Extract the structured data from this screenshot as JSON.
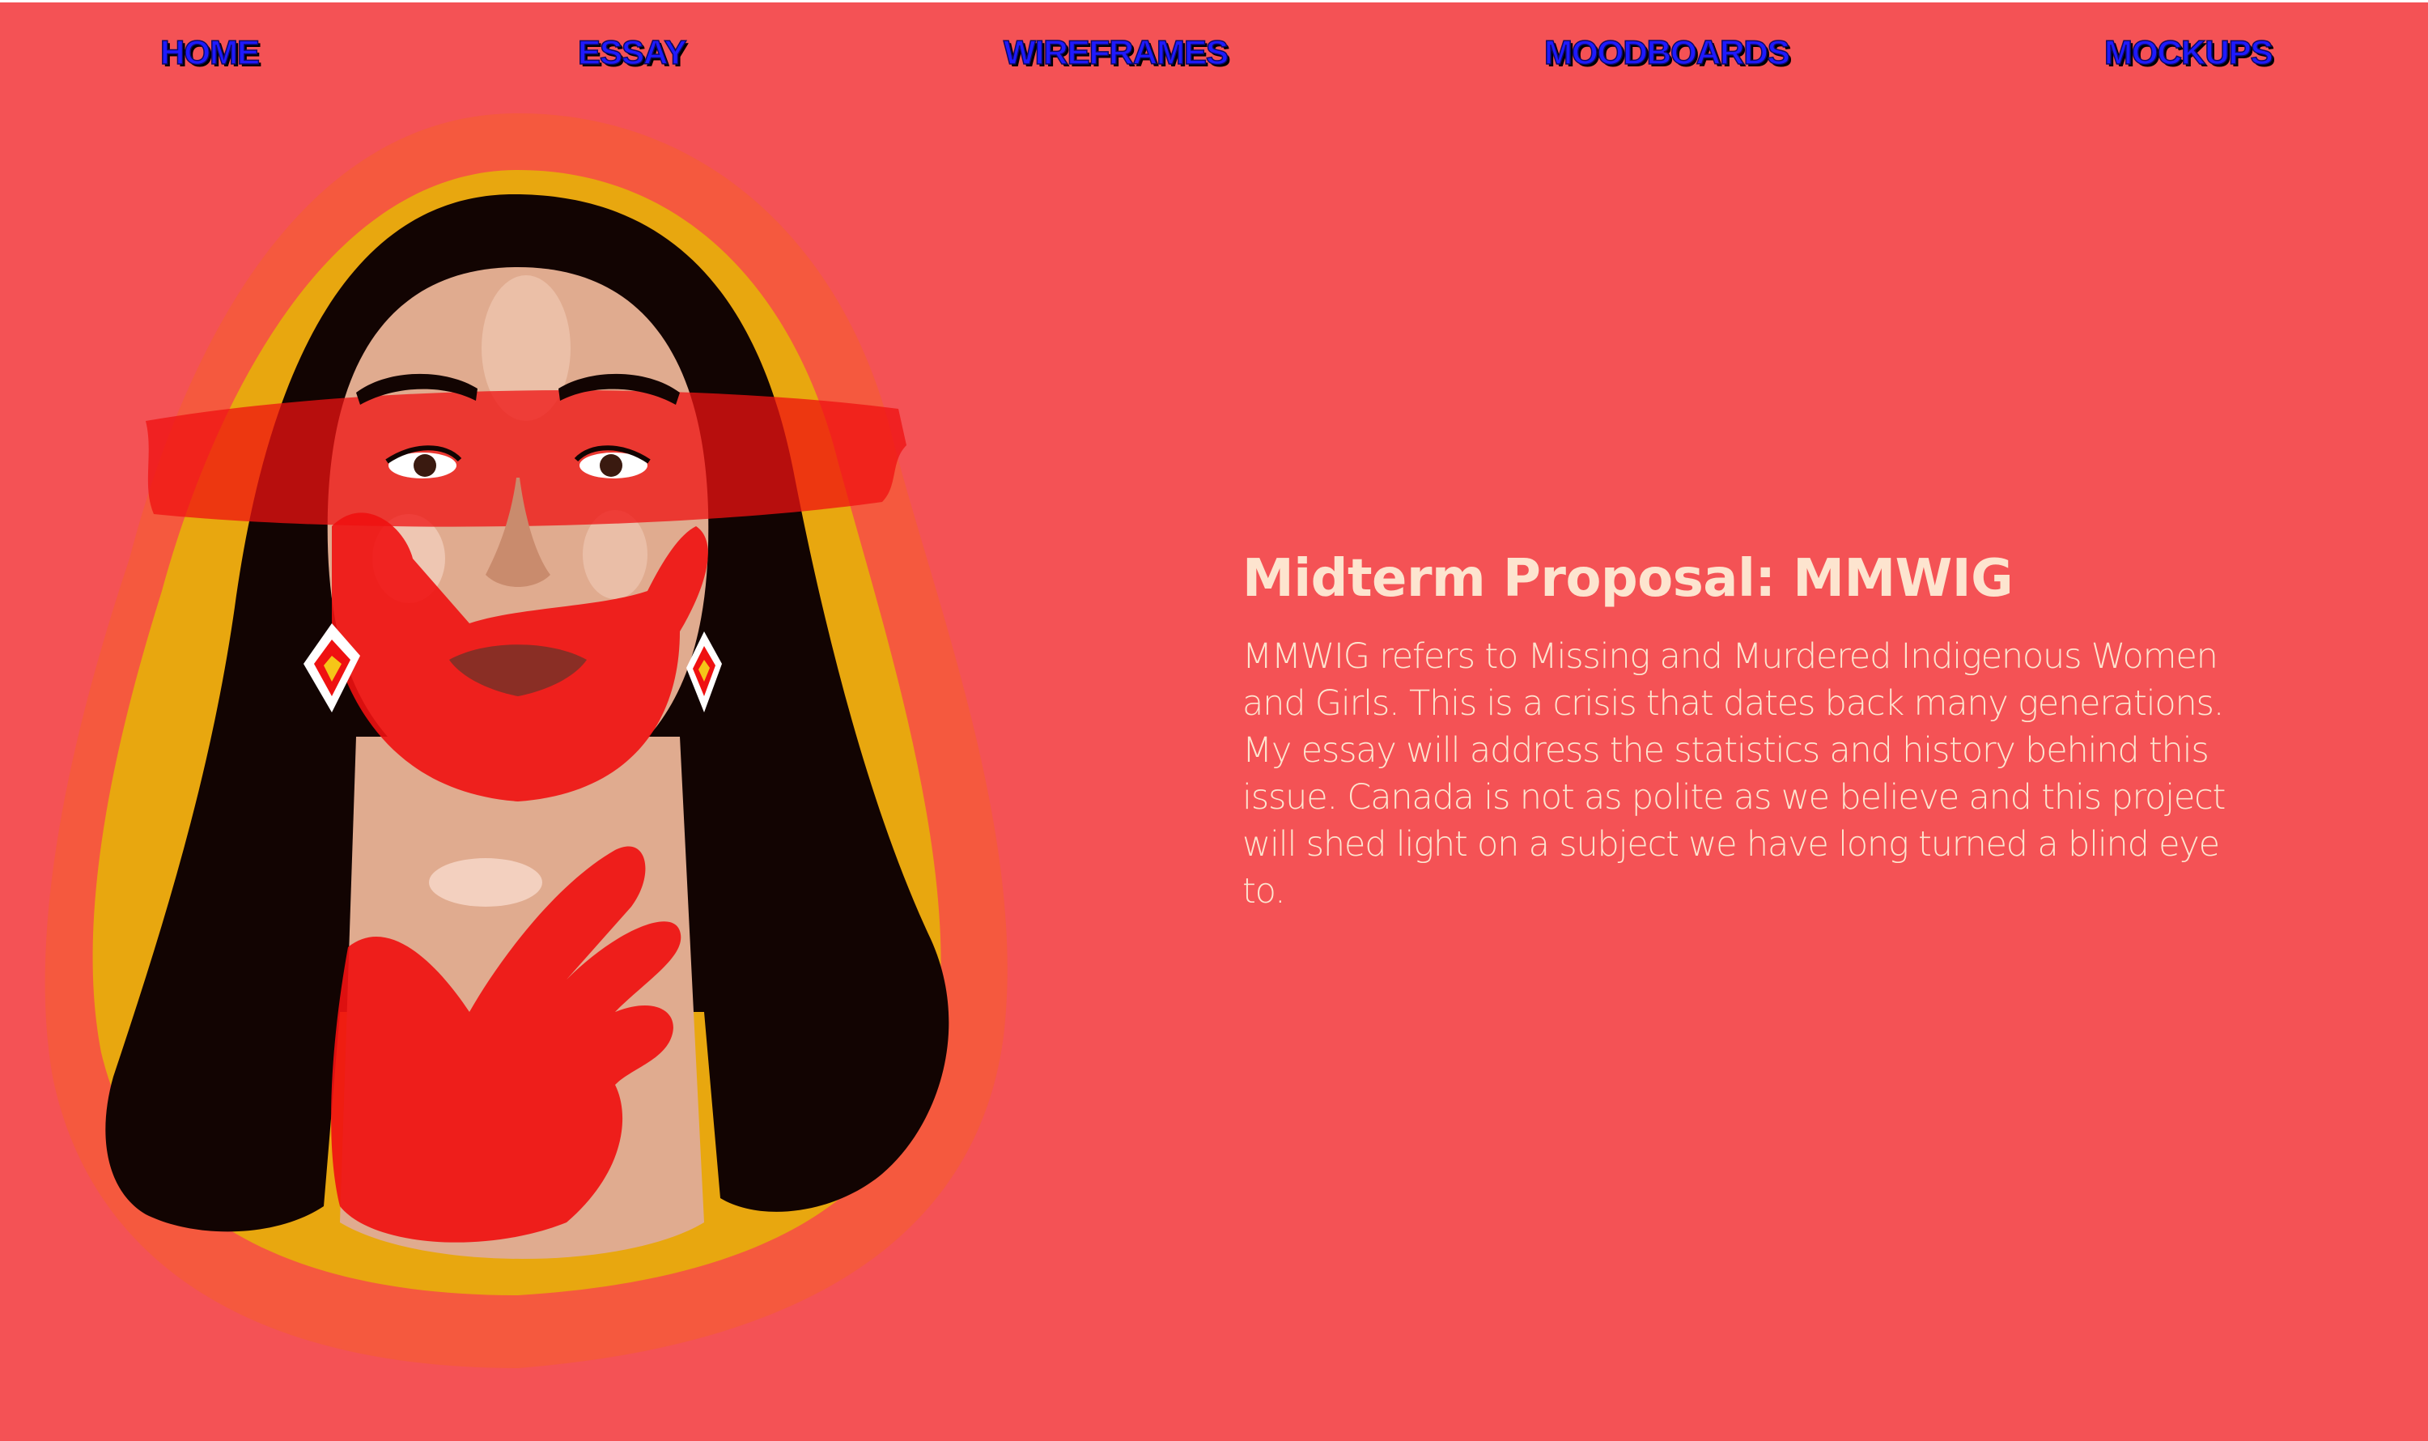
{
  "nav": {
    "items": [
      {
        "label": "HOME"
      },
      {
        "label": "ESSAY"
      },
      {
        "label": "WIREFRAMES"
      },
      {
        "label": "MOODBOARDS"
      },
      {
        "label": "MOCKUPS"
      }
    ]
  },
  "main": {
    "title": "Midterm Proposal: MMWIG",
    "body": "MMWIG refers to Missing and Murdered Indigenous Women and Girls. This is a crisis that dates back many generations. My essay will address the statistics and history behind this issue. Canada is not as polite as we believe and this project will shed light on a subject we have long turned a blind eye to."
  },
  "colors": {
    "background": "#f45255",
    "nav_text": "#1f1aff",
    "heading_text": "#fde4cf",
    "halo_orange": "#f5593e",
    "halo_gold": "#e8a70f",
    "hair": "#120402",
    "skin": "#e0ab8f",
    "handprint_red": "#ef1111"
  }
}
